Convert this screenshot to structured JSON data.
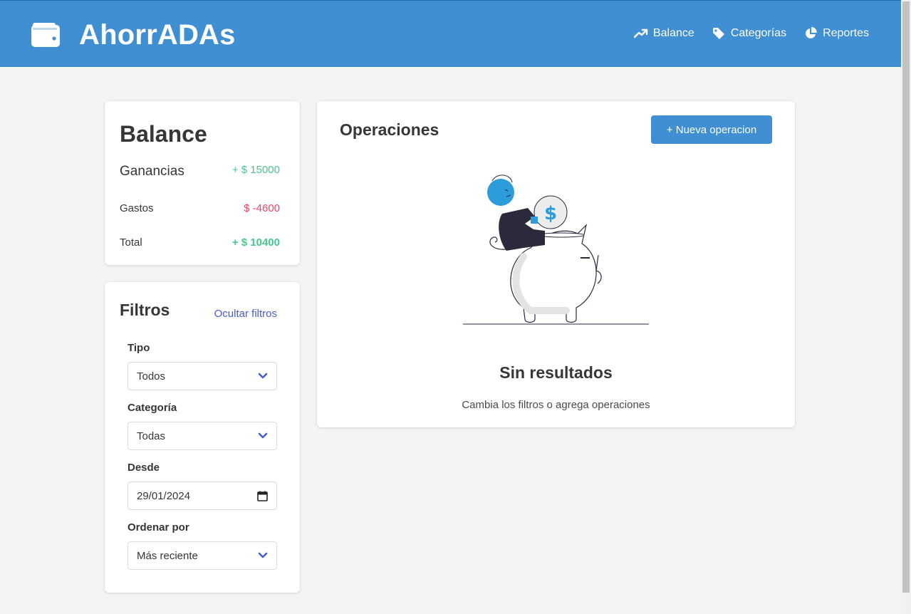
{
  "app": {
    "title": "AhorrADAs",
    "brand_color": "#3f8fd2"
  },
  "nav": {
    "items": [
      {
        "label": "Balance",
        "icon": "trend-up-icon"
      },
      {
        "label": "Categorías",
        "icon": "tag-icon"
      },
      {
        "label": "Reportes",
        "icon": "pie-chart-icon"
      }
    ]
  },
  "balance": {
    "title": "Balance",
    "rows": [
      {
        "label": "Ganancias",
        "value": "+ $ 15000",
        "color": "#48c78e"
      },
      {
        "label": "Gastos",
        "value": "$ -4600",
        "color": "#f14668"
      },
      {
        "label": "Total",
        "value": "+ $ 10400",
        "color": "#48c78e"
      }
    ]
  },
  "filters": {
    "title": "Filtros",
    "toggle_label": "Ocultar filtros",
    "fields": [
      {
        "label": "Tipo",
        "value": "Todos"
      },
      {
        "label": "Categoría",
        "value": "Todas"
      },
      {
        "label": "Desde",
        "value": "29/01/2024"
      },
      {
        "label": "Ordenar por",
        "value": "Más reciente"
      }
    ]
  },
  "operations": {
    "title": "Operaciones",
    "new_button": "+ Nueva operacion",
    "empty_title": "Sin resultados",
    "empty_subtitle": "Cambia los filtros o agrega operaciones"
  },
  "colors": {
    "link": "#485fc7",
    "illustration_accent": "#2d9cdb",
    "illustration_dark": "#2b2a3d"
  }
}
